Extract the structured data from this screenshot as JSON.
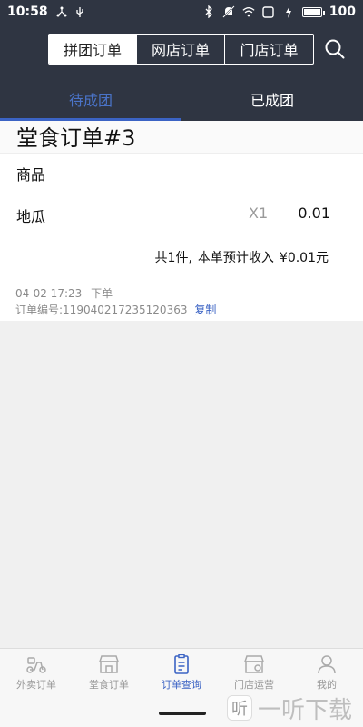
{
  "status_bar": {
    "time": "10:58",
    "battery": "100",
    "battery_level": 1.0
  },
  "header": {
    "segments": [
      "拼团订单",
      "网店订单",
      "门店订单"
    ],
    "active_segment": 0
  },
  "tabs": [
    "待成团",
    "已成团"
  ],
  "active_tab": 0,
  "order": {
    "title": "堂食订单#3",
    "section_label": "商品",
    "items": [
      {
        "name": "地瓜",
        "qty": "X1",
        "price": "0.01"
      }
    ],
    "summary_count": "共1件,",
    "summary_label": "本单预计收入",
    "summary_amount": "¥0.01元",
    "time": "04-02 17:23",
    "time_suffix": "下单",
    "order_no_label": "订单编号:",
    "order_no": "119040217235120363",
    "copy_label": "复制"
  },
  "bottom_nav": [
    {
      "label": "外卖订单",
      "icon": "delivery-scooter-icon"
    },
    {
      "label": "堂食订单",
      "icon": "storefront-icon"
    },
    {
      "label": "订单查询",
      "icon": "clipboard-icon"
    },
    {
      "label": "门店运营",
      "icon": "shop-settings-icon"
    },
    {
      "label": "我的",
      "icon": "person-icon"
    }
  ],
  "active_nav": 2,
  "watermark": {
    "text": "一听下载",
    "logo_char": "听"
  },
  "colors": {
    "header_bg": "#2f3542",
    "accent": "#3b63c4",
    "muted": "#999999"
  }
}
